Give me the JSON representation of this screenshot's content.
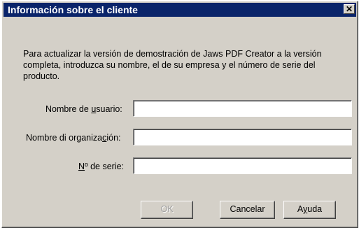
{
  "window": {
    "title": "Información sobre el cliente",
    "close_glyph": "✕"
  },
  "description": {
    "line1": "Para actualizar la versión de demostración de Jaws PDF Creator a la versión",
    "line2": "completa, introduzca su nombre, el de su empresa y el número de serie del",
    "line3": "producto."
  },
  "fields": {
    "username": {
      "label_pre": "Nombre de ",
      "label_accel": "u",
      "label_post": "suario:",
      "value": ""
    },
    "organization": {
      "label_pre": "Nombre di organiza",
      "label_accel": "c",
      "label_post": "ión:",
      "value": ""
    },
    "serial": {
      "label_pre": "",
      "label_accel": "N",
      "label_post": "º de serie:",
      "value": ""
    }
  },
  "buttons": {
    "ok": {
      "label": "OK",
      "enabled": false
    },
    "cancel": {
      "label": "Cancelar"
    },
    "help": {
      "label_pre": "A",
      "label_accel": "y",
      "label_post": "uda"
    }
  },
  "colors": {
    "titlebar": "#0a246a",
    "face": "#d4d0c8",
    "disabled_text": "#a0a0a0"
  },
  "icons": {
    "close": "close-icon"
  }
}
